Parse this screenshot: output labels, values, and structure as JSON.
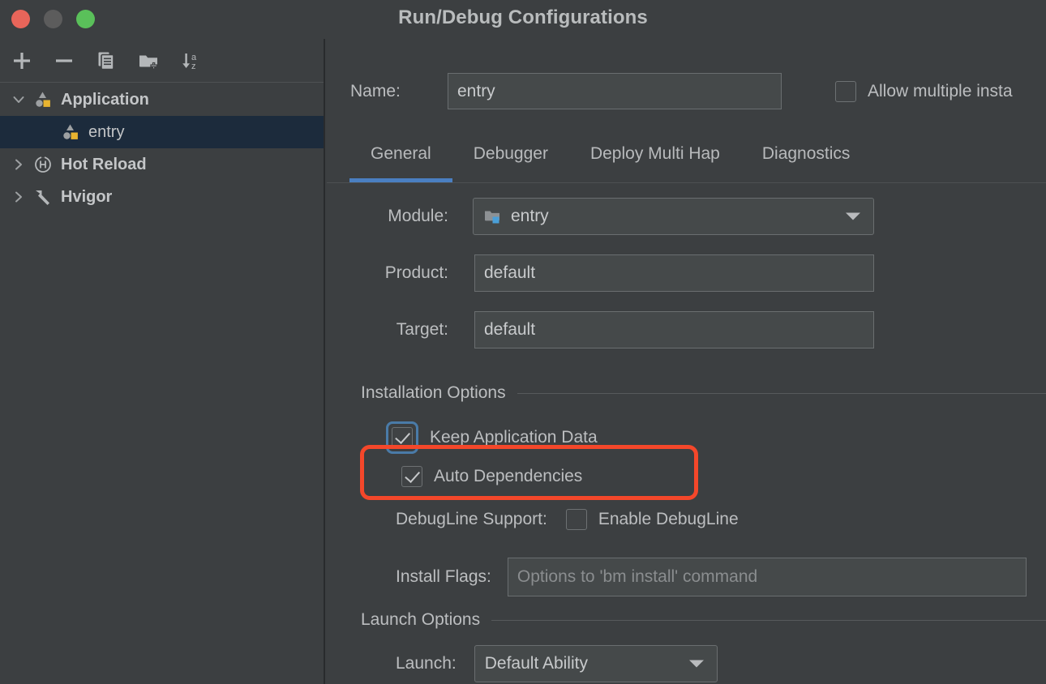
{
  "window": {
    "title": "Run/Debug Configurations",
    "traffic": {
      "close": "close-button",
      "minimize": "minimize-button",
      "maximize": "maximize-button"
    }
  },
  "colors": {
    "background": "#3c3f41",
    "selected_row": "#1c2b3c",
    "tab_accent": "#4a7fc1",
    "annotation": "#f4472a",
    "focus_ring": "#4a7ba8",
    "accent_yellow": "#e8b430",
    "accent_blue_icon": "#4a9fd8",
    "close_red": "#e8655a",
    "maximize_green": "#5ac05a",
    "minimize_gray": "#5c5c5c"
  },
  "left_panel": {
    "toolbar": [
      {
        "name": "add-configuration-button",
        "icon": "plus-icon",
        "tooltip": "Add New Configuration"
      },
      {
        "name": "remove-configuration-button",
        "icon": "minus-icon",
        "tooltip": "Remove Configuration"
      },
      {
        "name": "copy-configuration-button",
        "icon": "copy-icon",
        "tooltip": "Copy Configuration"
      },
      {
        "name": "new-folder-button",
        "icon": "new-folder-icon",
        "tooltip": "New Folder"
      },
      {
        "name": "sort-configurations-button",
        "icon": "sort-az-icon",
        "tooltip": "Sort Configurations"
      }
    ],
    "tree": [
      {
        "label": "Application",
        "icon": "application-icon",
        "twisty": "chevron-down-icon",
        "level": 0,
        "selected": false
      },
      {
        "label": "entry",
        "icon": "application-icon",
        "twisty": "",
        "level": 1,
        "selected": true
      },
      {
        "label": "Hot Reload",
        "icon": "hot-reload-icon",
        "twisty": "chevron-right-icon",
        "level": 0,
        "selected": false
      },
      {
        "label": "Hvigor",
        "icon": "hvigor-hammer-icon",
        "twisty": "chevron-right-icon",
        "level": 0,
        "selected": false
      }
    ]
  },
  "form": {
    "name_label": "Name:",
    "name_value": "entry",
    "allow_multiple_label": "Allow multiple insta",
    "allow_multiple_checked": false,
    "tabs": [
      {
        "label": "General",
        "active": true
      },
      {
        "label": "Debugger",
        "active": false
      },
      {
        "label": "Deploy Multi Hap",
        "active": false
      },
      {
        "label": "Diagnostics",
        "active": false
      }
    ],
    "module_label": "Module:",
    "module_value": "entry",
    "product_label": "Product:",
    "product_value": "default",
    "target_label": "Target:",
    "target_value": "default",
    "installation_options_title": "Installation Options",
    "keep_application_data_label": "Keep Application Data",
    "keep_application_data_checked": true,
    "auto_dependencies_label": "Auto Dependencies",
    "auto_dependencies_checked": true,
    "debugline_support_label": "DebugLine Support:",
    "enable_debugline_label": "Enable DebugLine",
    "enable_debugline_checked": false,
    "install_flags_label": "Install Flags:",
    "install_flags_placeholder": "Options to 'bm install' command",
    "install_flags_value": "",
    "launch_options_title": "Launch Options",
    "launch_label": "Launch:",
    "launch_value": "Default Ability"
  }
}
